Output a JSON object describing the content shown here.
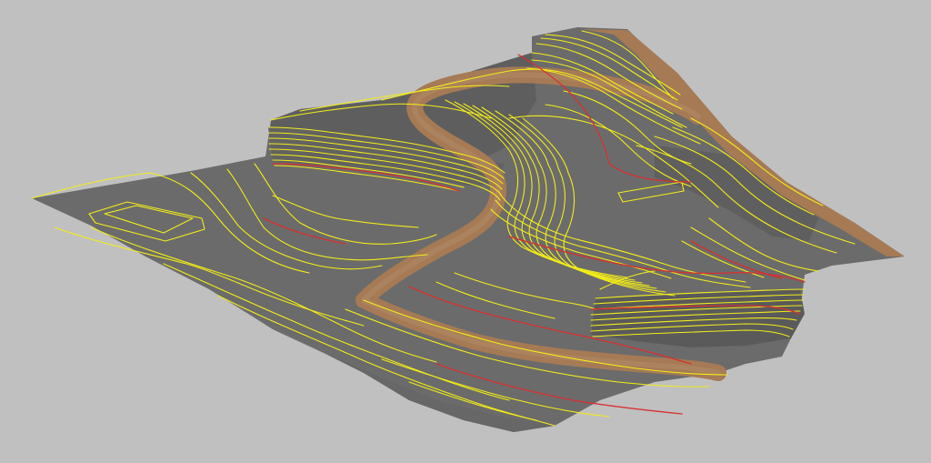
{
  "view": {
    "background_color": "#c0c0c0",
    "surface_color": "#6b6b6b",
    "surface_shade_color": "#5a5a5a",
    "road_color": "#a57a55",
    "minor_contour_color": "#f2ec1a",
    "major_contour_color": "#d83030"
  },
  "layers": {
    "surface": "terrain-surface",
    "road": "road-path",
    "contours_minor": "minor-contours",
    "contours_major": "major-contours"
  }
}
